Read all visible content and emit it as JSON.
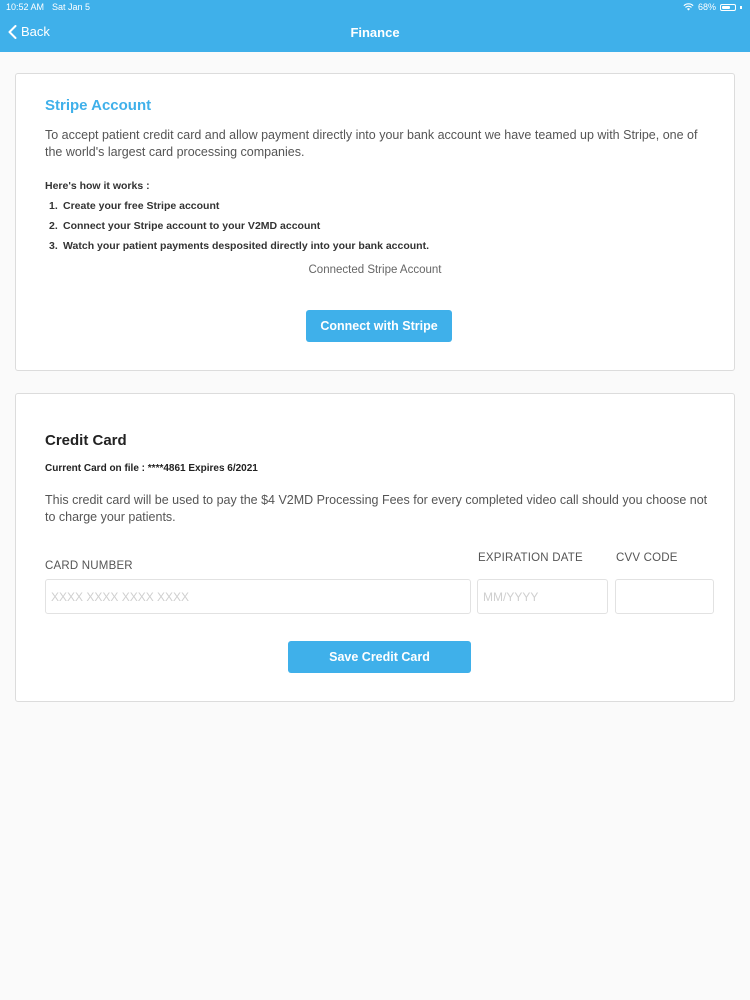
{
  "status_bar": {
    "time": "10:52 AM",
    "date": "Sat Jan 5",
    "battery": "68%",
    "battery_level": 0.68
  },
  "nav": {
    "back_label": "Back",
    "title": "Finance"
  },
  "stripe": {
    "title": "Stripe Account",
    "description": "To accept patient credit card and allow payment directly into your bank account we have teamed  up with Stripe, one of the world's largest card processing companies.",
    "how_heading": "Here's how it works :",
    "steps": [
      {
        "num": "1.",
        "text": "Create your free Stripe account"
      },
      {
        "num": "2.",
        "text": "Connect your Stripe account to your V2MD account"
      },
      {
        "num": "3.",
        "text": "Watch your patient payments desposited directly into your bank account."
      }
    ],
    "connected_label": "Connected Stripe Account",
    "connect_button": "Connect with Stripe"
  },
  "credit_card": {
    "title": "Credit Card",
    "current_card": "Current Card on file :  ****4861 Expires 6/2021",
    "description": "This credit card will be used to pay the $4 V2MD Processing Fees for every completed video call should you choose not to charge your patients.",
    "card_number_label": "CARD NUMBER",
    "card_number_placeholder": "XXXX XXXX XXXX XXXX",
    "expiration_label": "EXPIRATION DATE",
    "expiration_placeholder": "MM/YYYY",
    "cvv_label": "CVV CODE",
    "cvv_placeholder": "",
    "save_button": "Save Credit Card"
  },
  "colors": {
    "accent": "#3fb0ea"
  }
}
